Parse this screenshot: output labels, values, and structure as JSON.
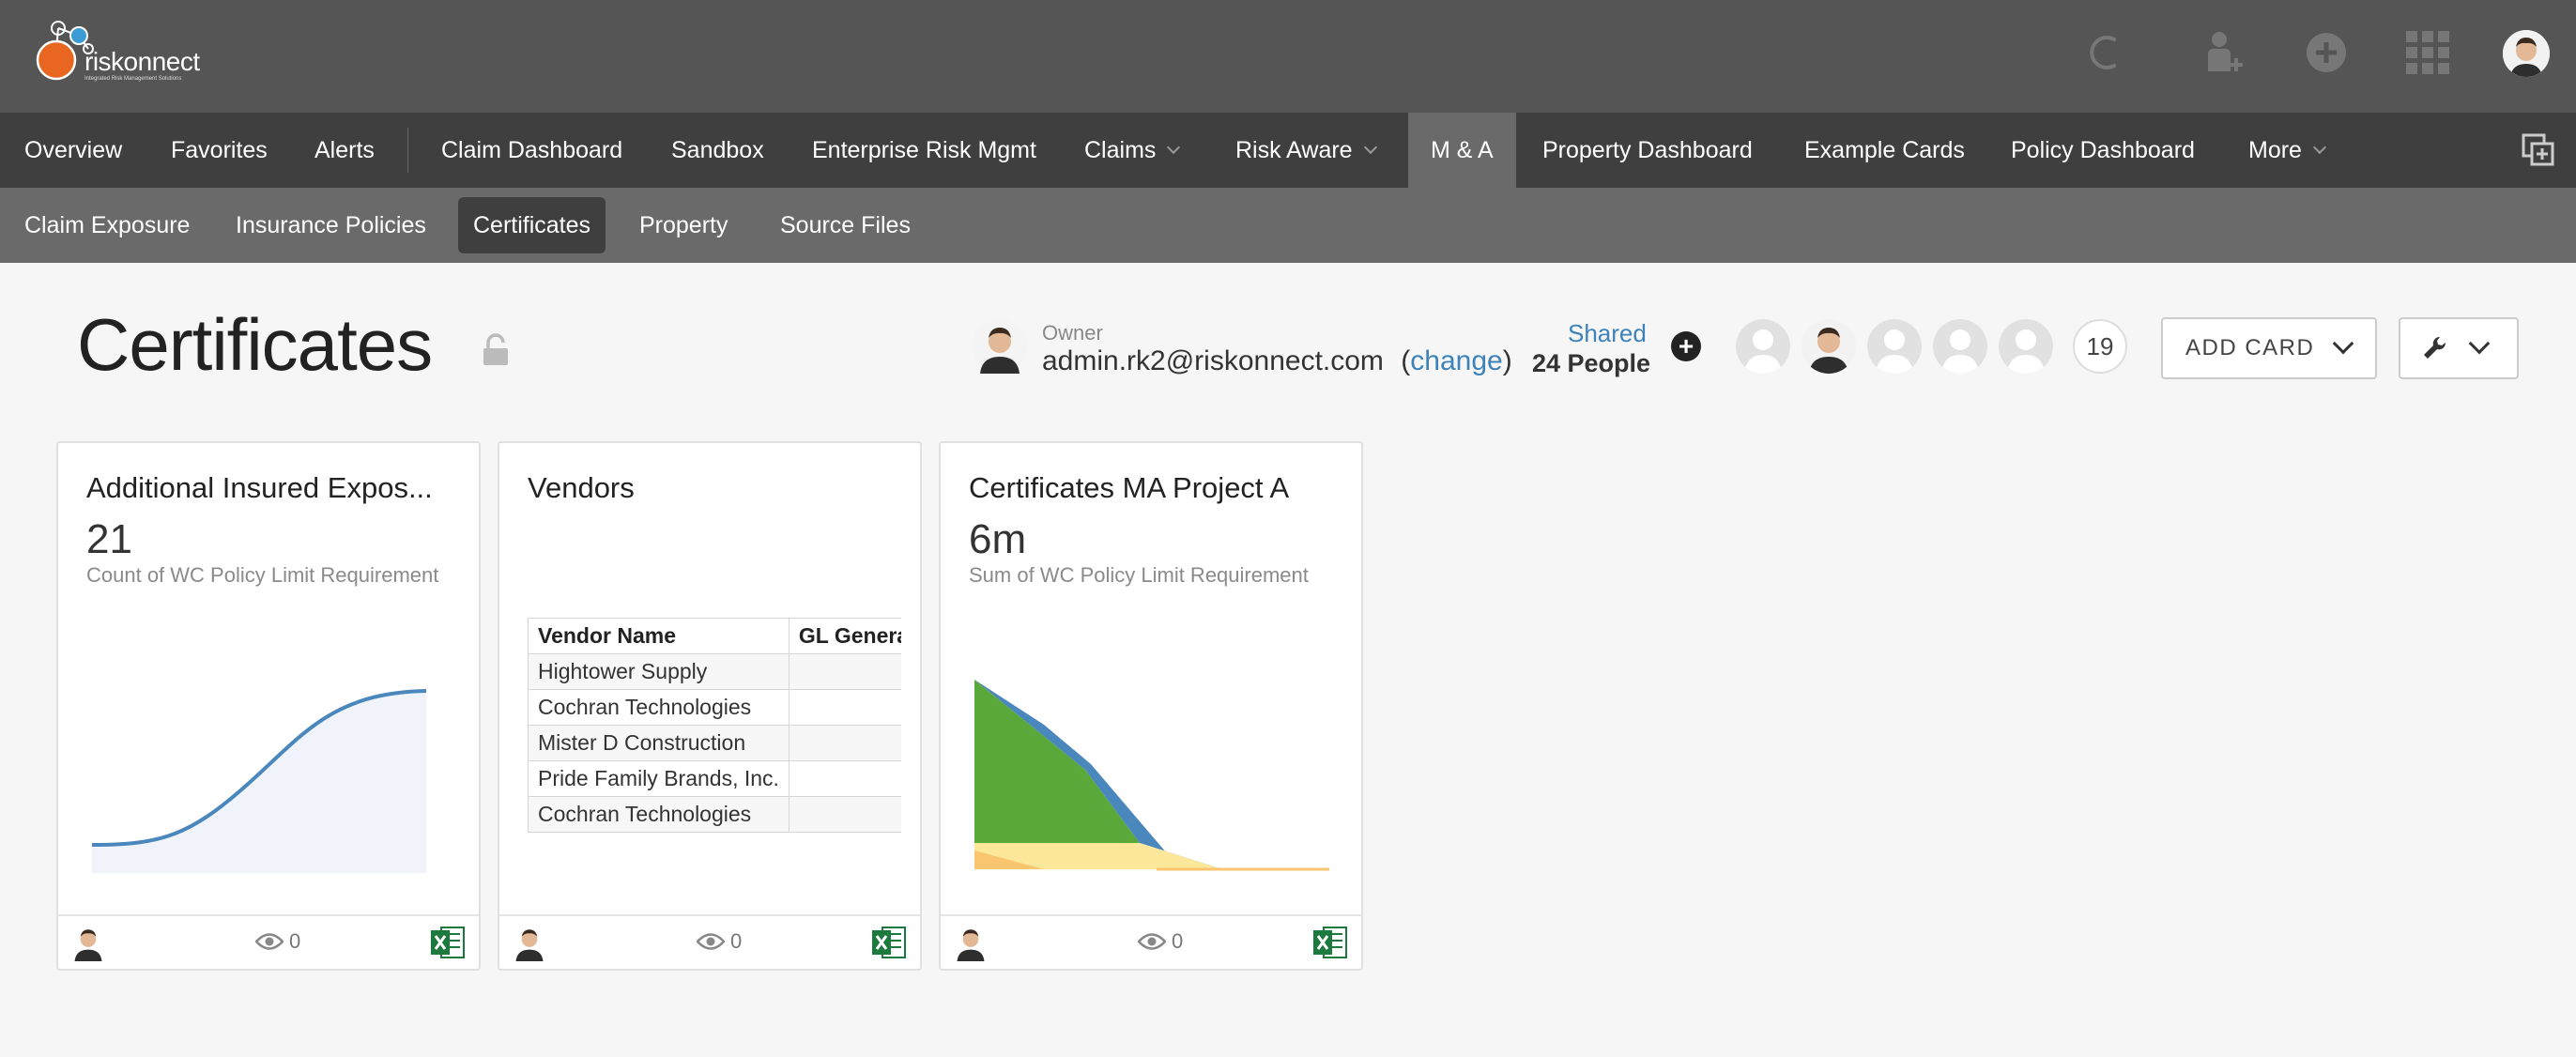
{
  "brand": {
    "name": "riskonnect",
    "tagline": "Integrated Risk Management Solutions"
  },
  "nav_primary": [
    {
      "label": "Overview"
    },
    {
      "label": "Favorites"
    },
    {
      "label": "Alerts"
    },
    {
      "label": "Claim Dashboard"
    },
    {
      "label": "Sandbox"
    },
    {
      "label": "Enterprise Risk Mgmt"
    },
    {
      "label": "Claims"
    },
    {
      "label": "Risk Aware"
    },
    {
      "label": "M & A"
    },
    {
      "label": "Property Dashboard"
    },
    {
      "label": "Example Cards"
    },
    {
      "label": "Policy Dashboard"
    },
    {
      "label": "More"
    }
  ],
  "nav_secondary": [
    {
      "label": "Claim Exposure"
    },
    {
      "label": "Insurance Policies"
    },
    {
      "label": "Certificates"
    },
    {
      "label": "Property"
    },
    {
      "label": "Source Files"
    }
  ],
  "page": {
    "title": "Certificates",
    "owner_label": "Owner",
    "owner_email": "admin.rk2@riskonnect.com",
    "change_open": "(",
    "change_link": "change",
    "change_close": ")",
    "shared_label": "Shared",
    "shared_count": "24 People",
    "more_people": "19",
    "add_card": "ADD CARD"
  },
  "cards": [
    {
      "title": "Additional Insured Expos...",
      "metric": "21",
      "subtitle": "Count of WC Policy Limit Requirement",
      "views": "0"
    },
    {
      "title": "Vendors",
      "table": {
        "columns": [
          "Vendor Name",
          "GL Genera"
        ],
        "rows": [
          [
            "Hightower Supply",
            ""
          ],
          [
            "Cochran Technologies",
            ""
          ],
          [
            "Mister D Construction",
            ""
          ],
          [
            "Pride Family Brands, Inc.",
            ""
          ],
          [
            "Cochran Technologies",
            ""
          ]
        ]
      },
      "views": "0"
    },
    {
      "title": "Certificates MA Project A",
      "metric": "6m",
      "subtitle": "Sum of WC Policy Limit Requirement",
      "views": "0"
    }
  ],
  "colors": {
    "header_bg": "#555555",
    "nav_bg": "#3f3f3f",
    "subnav_bg": "#6a6a6a",
    "link": "#3d82b8",
    "excel_green": "#1d7a3e",
    "chart_blue": "#4a87bd",
    "chart_green": "#5aa83a",
    "chart_yellow": "#fce79a",
    "chart_orange": "#f9c66f"
  }
}
